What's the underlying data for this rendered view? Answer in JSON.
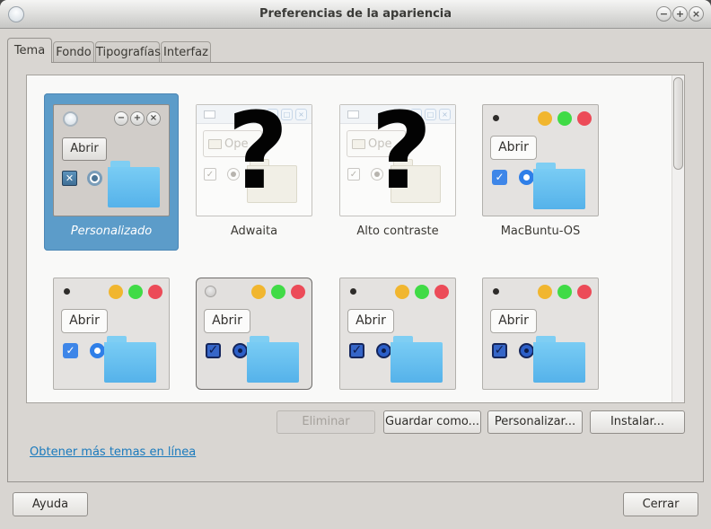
{
  "window": {
    "title": "Preferencias de la apariencia",
    "controls": {
      "minimize": "−",
      "maximize": "+",
      "close": "×"
    }
  },
  "tabs": {
    "active": "Tema",
    "items": [
      {
        "label": "Tema"
      },
      {
        "label": "Fondo"
      },
      {
        "label": "Tipografías"
      },
      {
        "label": "Interfaz"
      }
    ]
  },
  "glyphs": {
    "check": "✓",
    "cross": "✕",
    "minimize": "−",
    "maximize": "+",
    "restore": "□",
    "close": "×",
    "missing_thumbnail": "?"
  },
  "theme_list": {
    "items": [
      {
        "label": "Personalizado",
        "variant": "custom",
        "selected": true,
        "preview_button": "Abrir"
      },
      {
        "label": "Adwaita",
        "variant": "adwaita",
        "selected": false,
        "preview_button": "Ope",
        "missing_thumbnail": "?"
      },
      {
        "label": "Alto contraste",
        "variant": "adwaita",
        "selected": false,
        "preview_button": "Ope",
        "missing_thumbnail": "?"
      },
      {
        "label": "MacBuntu-OS",
        "variant": "mac",
        "selected": false,
        "preview_button": "Abrir"
      },
      {
        "variant": "mac",
        "selected": false,
        "preview_button": "Abrir"
      },
      {
        "variant": "mac-dark",
        "selected": false,
        "preview_button": "Abrir"
      },
      {
        "variant": "mac-dark",
        "selected": false,
        "preview_button": "Abrir"
      },
      {
        "variant": "mac-dark",
        "selected": false,
        "preview_button": "Abrir"
      }
    ]
  },
  "actions": {
    "eliminar": {
      "label": "Eliminar",
      "enabled": false
    },
    "guardar": {
      "label": "Guardar como..."
    },
    "personalizar": {
      "label": "Personalizar..."
    },
    "instalar": {
      "label": "Instalar..."
    }
  },
  "link": {
    "label": "Obtener más temas en línea"
  },
  "footer": {
    "help": "Ayuda",
    "close": "Cerrar"
  },
  "colors": {
    "selection_blue": "#5C9CC9",
    "link_blue": "#1A7ABD",
    "accent_blue": "#3E86E8",
    "folder_blue": "#66C0F0",
    "traffic_yellow": "#F1B62F",
    "traffic_green": "#40DB46",
    "traffic_red": "#EC4B58"
  }
}
